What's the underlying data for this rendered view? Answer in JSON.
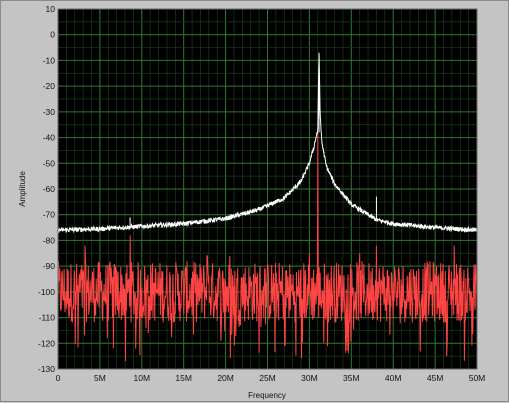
{
  "chart_data": {
    "type": "line",
    "xlabel": "Frequency",
    "ylabel": "Amplitude",
    "xlim": [
      0,
      50000000
    ],
    "ylim": [
      -130,
      10
    ],
    "x_tick_labels": [
      "0",
      "5M",
      "10M",
      "15M",
      "20M",
      "25M",
      "30M",
      "35M",
      "40M",
      "45M",
      "50M"
    ],
    "y_tick_labels": [
      "10",
      "0",
      "-10",
      "-20",
      "-30",
      "-40",
      "-50",
      "-60",
      "-70",
      "-80",
      "-90",
      "-100",
      "-110",
      "-120",
      "-130"
    ],
    "grid": true,
    "series": [
      {
        "color": "#ffffff",
        "style": "line",
        "noise_amplitude": 0.9,
        "x": [
          0,
          5000000,
          10000000,
          15000000,
          20000000,
          24000000,
          27000000,
          29000000,
          30000000,
          30500000,
          31000000,
          31150000,
          31300000,
          31500000,
          32000000,
          33000000,
          35000000,
          38000000,
          40000000,
          45000000,
          50000000
        ],
        "values": [
          -76,
          -75.5,
          -74.5,
          -73.5,
          -71.5,
          -68,
          -63.5,
          -57,
          -50,
          -44,
          -37,
          -7,
          -33,
          -42,
          -51,
          -58,
          -66,
          -72,
          -73.5,
          -75,
          -76
        ],
        "spurs": [
          {
            "x": 8600000,
            "y": -71
          },
          {
            "x": 38000000,
            "y": -63
          }
        ]
      },
      {
        "color": "#ff4444",
        "style": "line",
        "noise_floor": -100,
        "noise_band": [
          -88,
          -112
        ],
        "min_value": -127,
        "x_range": [
          0,
          50000000
        ],
        "peaks": [
          {
            "x": 31000000,
            "y": -38
          },
          {
            "x": 8600000,
            "y": -78
          },
          {
            "x": 38000000,
            "y": -82
          },
          {
            "x": 3200000,
            "y": -82
          },
          {
            "x": 17800000,
            "y": -86
          },
          {
            "x": 20500000,
            "y": -86
          },
          {
            "x": 30000000,
            "y": -85
          },
          {
            "x": 47300000,
            "y": -82
          },
          {
            "x": 36000000,
            "y": -85
          }
        ]
      }
    ]
  }
}
